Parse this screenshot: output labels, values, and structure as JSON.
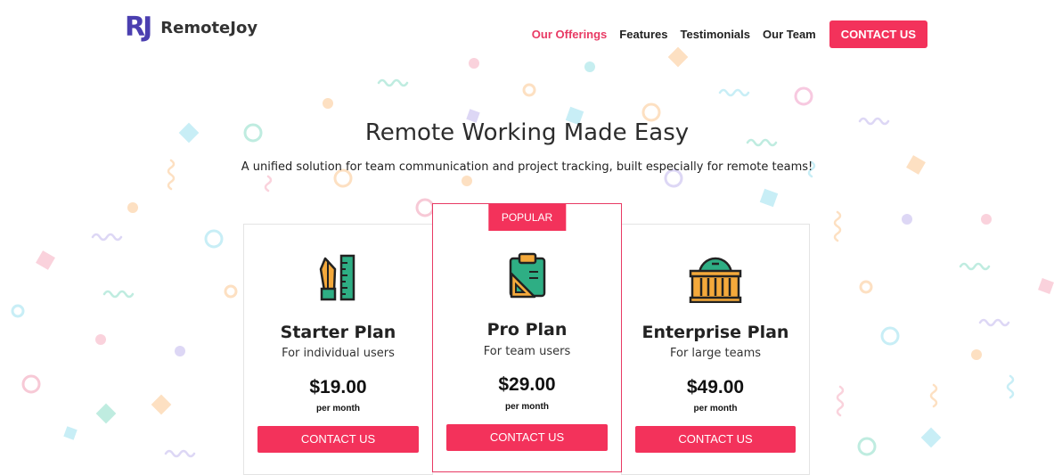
{
  "brand": {
    "mark": "RJ",
    "name": "RemoteJoy"
  },
  "nav": {
    "links": [
      "Our Offerings",
      "Features",
      "Testimonials",
      "Our Team"
    ],
    "active": "Our Offerings",
    "cta": "CONTACT US"
  },
  "hero": {
    "title": "Remote Working Made Easy",
    "subtitle": "A unified solution for team communication and project tracking, built especially for remote teams!"
  },
  "plans": [
    {
      "name": "Starter Plan",
      "description": "For individual users",
      "price": "$19.00",
      "period": "per month",
      "button": "CONTACT US",
      "icon": "drafting-tools-icon"
    },
    {
      "name": "Pro Plan",
      "description": "For team users",
      "price": "$29.00",
      "period": "per month",
      "button": "CONTACT US",
      "icon": "clipboard-ruler-icon",
      "badge": "POPULAR"
    },
    {
      "name": "Enterprise Plan",
      "description": "For large teams",
      "price": "$49.00",
      "period": "per month",
      "button": "CONTACT US",
      "icon": "building-icon"
    }
  ],
  "colors": {
    "accent": "#f3325b",
    "brand": "#4b3fb0",
    "active_link": "#e83a64",
    "icon_orange": "#f4a93b",
    "icon_green": "#2eae84"
  }
}
